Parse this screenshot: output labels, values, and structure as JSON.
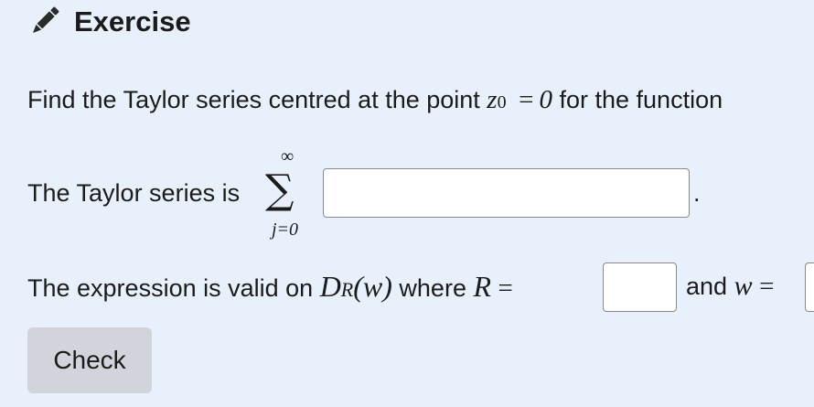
{
  "exercise": {
    "title": "Exercise",
    "icon": "pencil-icon"
  },
  "question": {
    "prefix": "Find the Taylor series centred at the point",
    "point_var": "z",
    "point_sub": "0",
    "equals": "=",
    "point_value": "0",
    "suffix": "for the function"
  },
  "series": {
    "label": "The Taylor series is",
    "sum_symbol": "∑",
    "upper_limit": "∞",
    "lower_limit": "j=0",
    "end_punct": ".",
    "answer_value": ""
  },
  "validity": {
    "prefix": "The expression is valid on",
    "domain_var": "D",
    "domain_sub": "R",
    "domain_arg": "(w)",
    "where_text": "where",
    "radius_var": "R",
    "equals": "=",
    "radius_value": "",
    "and_text": "and",
    "center_var": "w",
    "equals2": "=",
    "center_value": ""
  },
  "actions": {
    "check_label": "Check"
  }
}
